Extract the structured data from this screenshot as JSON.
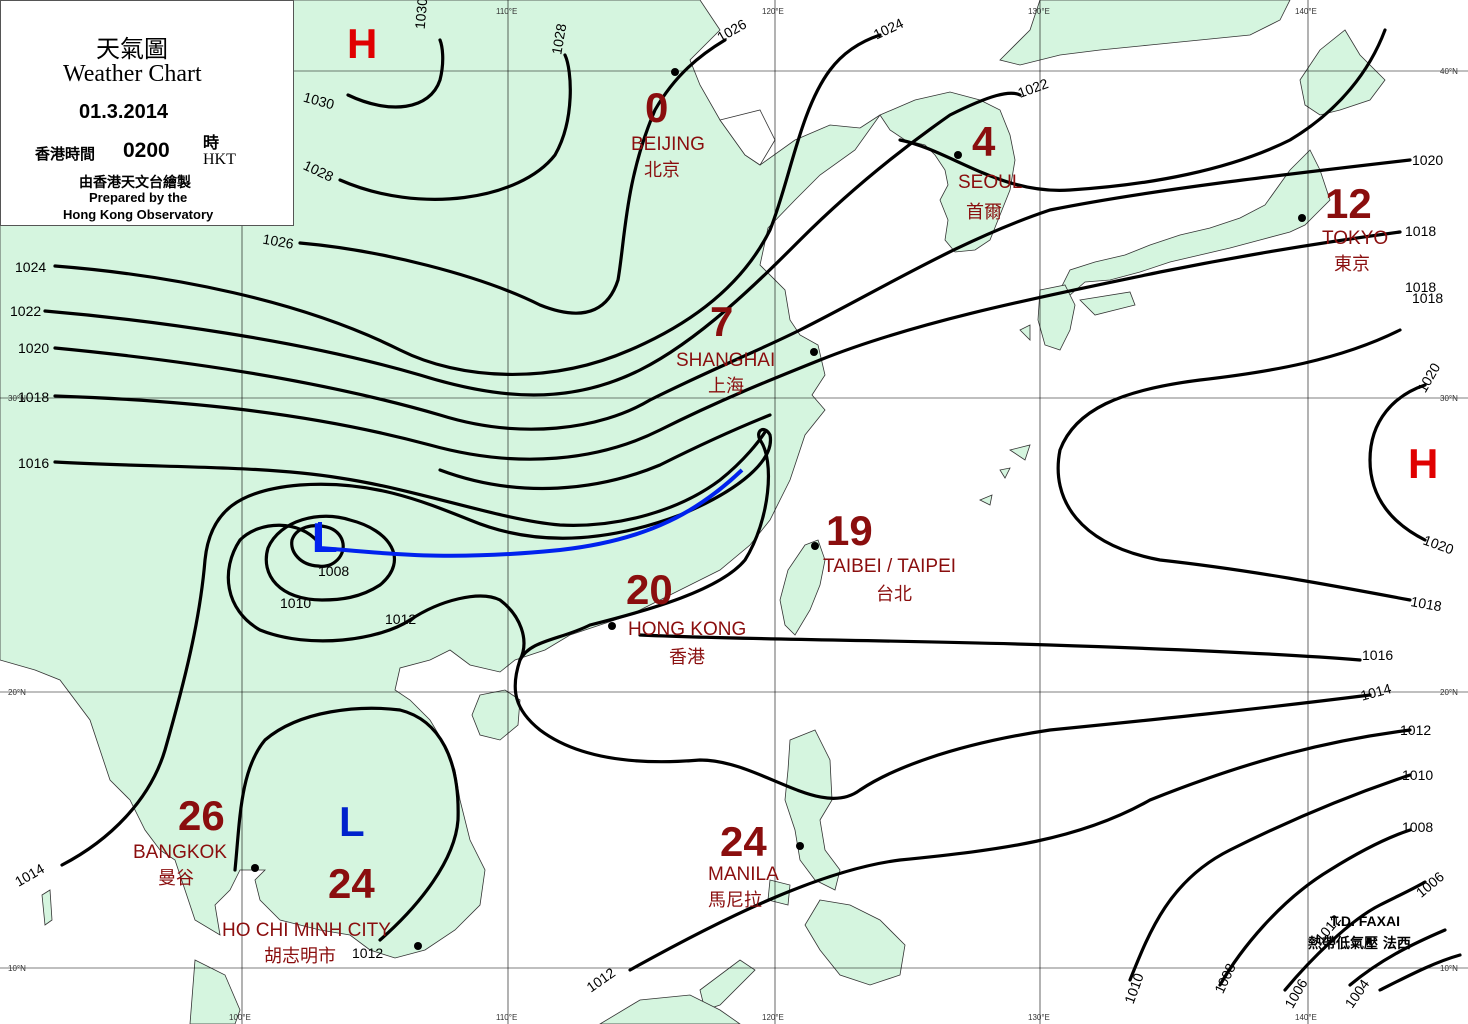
{
  "legend": {
    "title_cn": "天氣圖",
    "title_en": "Weather Chart",
    "date": "01.3.2014",
    "time_cn_left": "香港時間",
    "time": "0200",
    "time_cn_right": "時",
    "time_en": "HKT",
    "prepared_cn": "由香港天文台繪製",
    "prepared_en_1": "Prepared by the",
    "prepared_en_2": "Hong Kong Observatory"
  },
  "grid": {
    "lon_labels": [
      "110°E",
      "120°E",
      "130°E",
      "140°E",
      "100°E",
      "110°E",
      "120°E",
      "130°E",
      "140°E"
    ],
    "lat_labels": [
      "40°N",
      "30°N",
      "20°N",
      "10°N",
      "30°N",
      "20°N",
      "10°N"
    ]
  },
  "cities": [
    {
      "name": "BEIJING",
      "name_cn": "北京",
      "temp": "0"
    },
    {
      "name": "SEOUL",
      "name_cn": "首爾",
      "temp": "4"
    },
    {
      "name": "TOKYO",
      "name_cn": "東京",
      "temp": "12"
    },
    {
      "name": "SHANGHAI",
      "name_cn": "上海",
      "temp": "7"
    },
    {
      "name": "TAIBEI / TAIPEI",
      "name_cn": "台北",
      "temp": "19"
    },
    {
      "name": "HONG KONG",
      "name_cn": "香港",
      "temp": "20"
    },
    {
      "name": "BANGKOK",
      "name_cn": "曼谷",
      "temp": "26"
    },
    {
      "name": "HO CHI MINH CITY",
      "name_cn": "胡志明市",
      "temp": "24"
    },
    {
      "name": "MANILA",
      "name_cn": "馬尼拉",
      "temp": "24"
    }
  ],
  "pressure_centers": [
    {
      "label": "H",
      "color": "#e00000"
    },
    {
      "label": "H",
      "color": "#e00000"
    },
    {
      "label": "L",
      "color": "#0022cc"
    },
    {
      "label": "L",
      "color": "#0022cc"
    }
  ],
  "isobar_labels": [
    "1030",
    "1030",
    "1028",
    "1028",
    "1026",
    "1026",
    "1024",
    "1024",
    "1022",
    "1022",
    "1020",
    "1020",
    "1020",
    "1020",
    "1018",
    "1018",
    "1018",
    "1018",
    "1016",
    "1016",
    "1014",
    "1014",
    "1012",
    "1012",
    "1012",
    "1012",
    "1010",
    "1010",
    "1010",
    "1008",
    "1008",
    "1008",
    "1006",
    "1006",
    "1004",
    "1012",
    "1018"
  ],
  "storm": {
    "name_en": "T.D. FAXAI",
    "name_cn": "熱帶低氣壓 法西"
  },
  "colors": {
    "land": "#d5f5df",
    "sea": "#ffffff",
    "isobar": "#000000",
    "front": "#0022ee",
    "city": "#8a0e0e",
    "high": "#e00000",
    "low": "#0022cc"
  }
}
